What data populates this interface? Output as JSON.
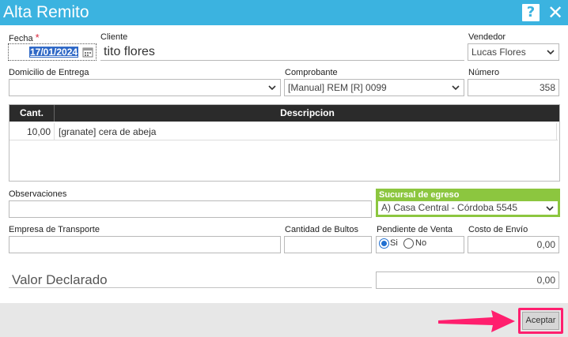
{
  "window": {
    "title": "Alta Remito",
    "help_label": "?",
    "close_label": "✕"
  },
  "form": {
    "fecha": {
      "label": "Fecha",
      "required_mark": "*",
      "value": "17/01/2024"
    },
    "cliente": {
      "label": "Cliente",
      "value": "tito flores"
    },
    "vendedor": {
      "label": "Vendedor",
      "value": "Lucas Flores"
    },
    "domicilio": {
      "label": "Domicilio de Entrega",
      "value": ""
    },
    "comprobante": {
      "label": "Comprobante",
      "value": "[Manual] REM [R] 0099"
    },
    "numero": {
      "label": "Número",
      "value": "358"
    },
    "observaciones": {
      "label": "Observaciones",
      "value": ""
    },
    "sucursal": {
      "label": "Sucursal de egreso",
      "value": "A) Casa Central - Córdoba 5545"
    },
    "transporte": {
      "label": "Empresa de Transporte",
      "value": ""
    },
    "bultos": {
      "label": "Cantidad de Bultos",
      "value": ""
    },
    "pendiente": {
      "label": "Pendiente de Venta",
      "options": [
        "Si",
        "No"
      ],
      "selected": "Si"
    },
    "costo_envio": {
      "label": "Costo de Envío",
      "value": "0,00"
    },
    "valor_declarado": {
      "label": "Valor Declarado",
      "value": "0,00"
    }
  },
  "grid": {
    "columns": [
      "Cant.",
      "Descripcion"
    ],
    "rows": [
      {
        "cant": "10,00",
        "descripcion": "[granate] cera de abeja"
      }
    ]
  },
  "footer": {
    "accept_label": "Aceptar"
  },
  "colors": {
    "titlebar": "#3bb3e0",
    "sucursal_accent": "#8cc63f",
    "highlight": "#ff1f6e",
    "date_selection": "#3069c6"
  }
}
